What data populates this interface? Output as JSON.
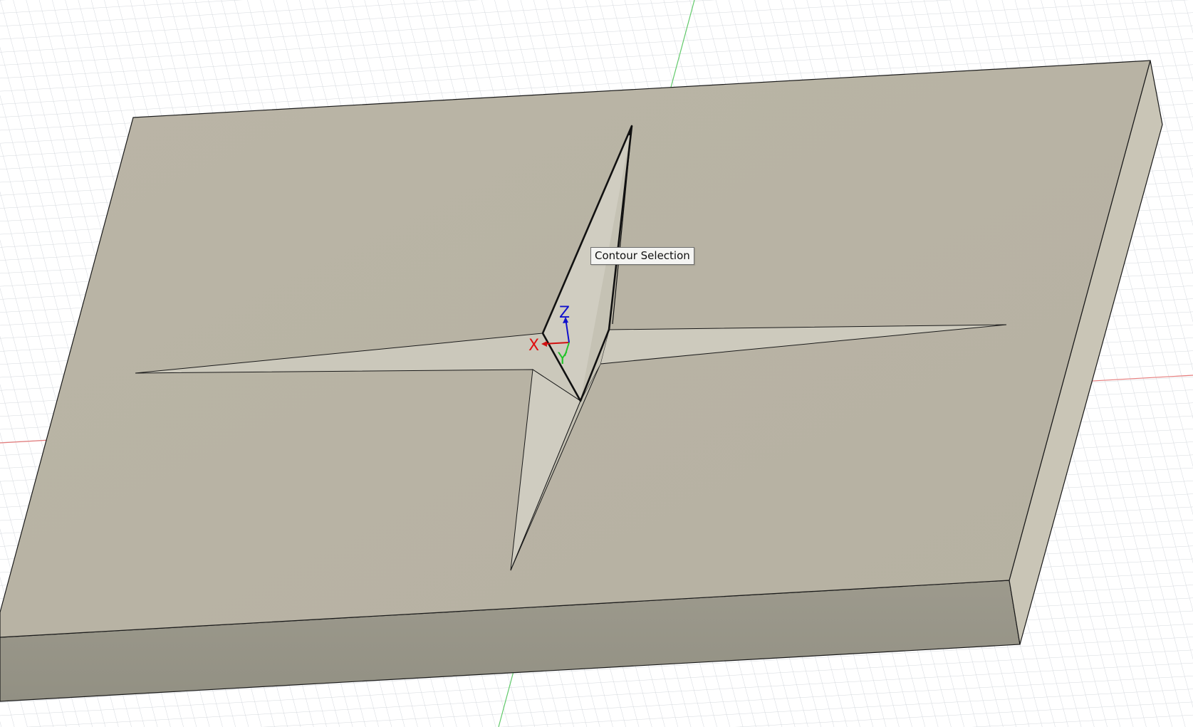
{
  "viewport": {
    "tooltip": "Contour Selection",
    "triad": {
      "x_label": "X",
      "y_label": "Y",
      "z_label": "Z"
    }
  },
  "colors": {
    "background": "#ffffff",
    "grid_line": "#cfd3d8",
    "x_axis_line": "#e26a6a",
    "y_axis_line": "#4fc35a",
    "top_face": "#b8b3a4",
    "front_face": "#999689",
    "side_face": "#cac6b7",
    "pocket_face_light": "#cfccbf",
    "pocket_face_mid": "#c4c1b3",
    "edge": "#1a1a1a",
    "triad_x": "#e01010",
    "triad_y": "#22c42a",
    "triad_z": "#1010cc"
  }
}
